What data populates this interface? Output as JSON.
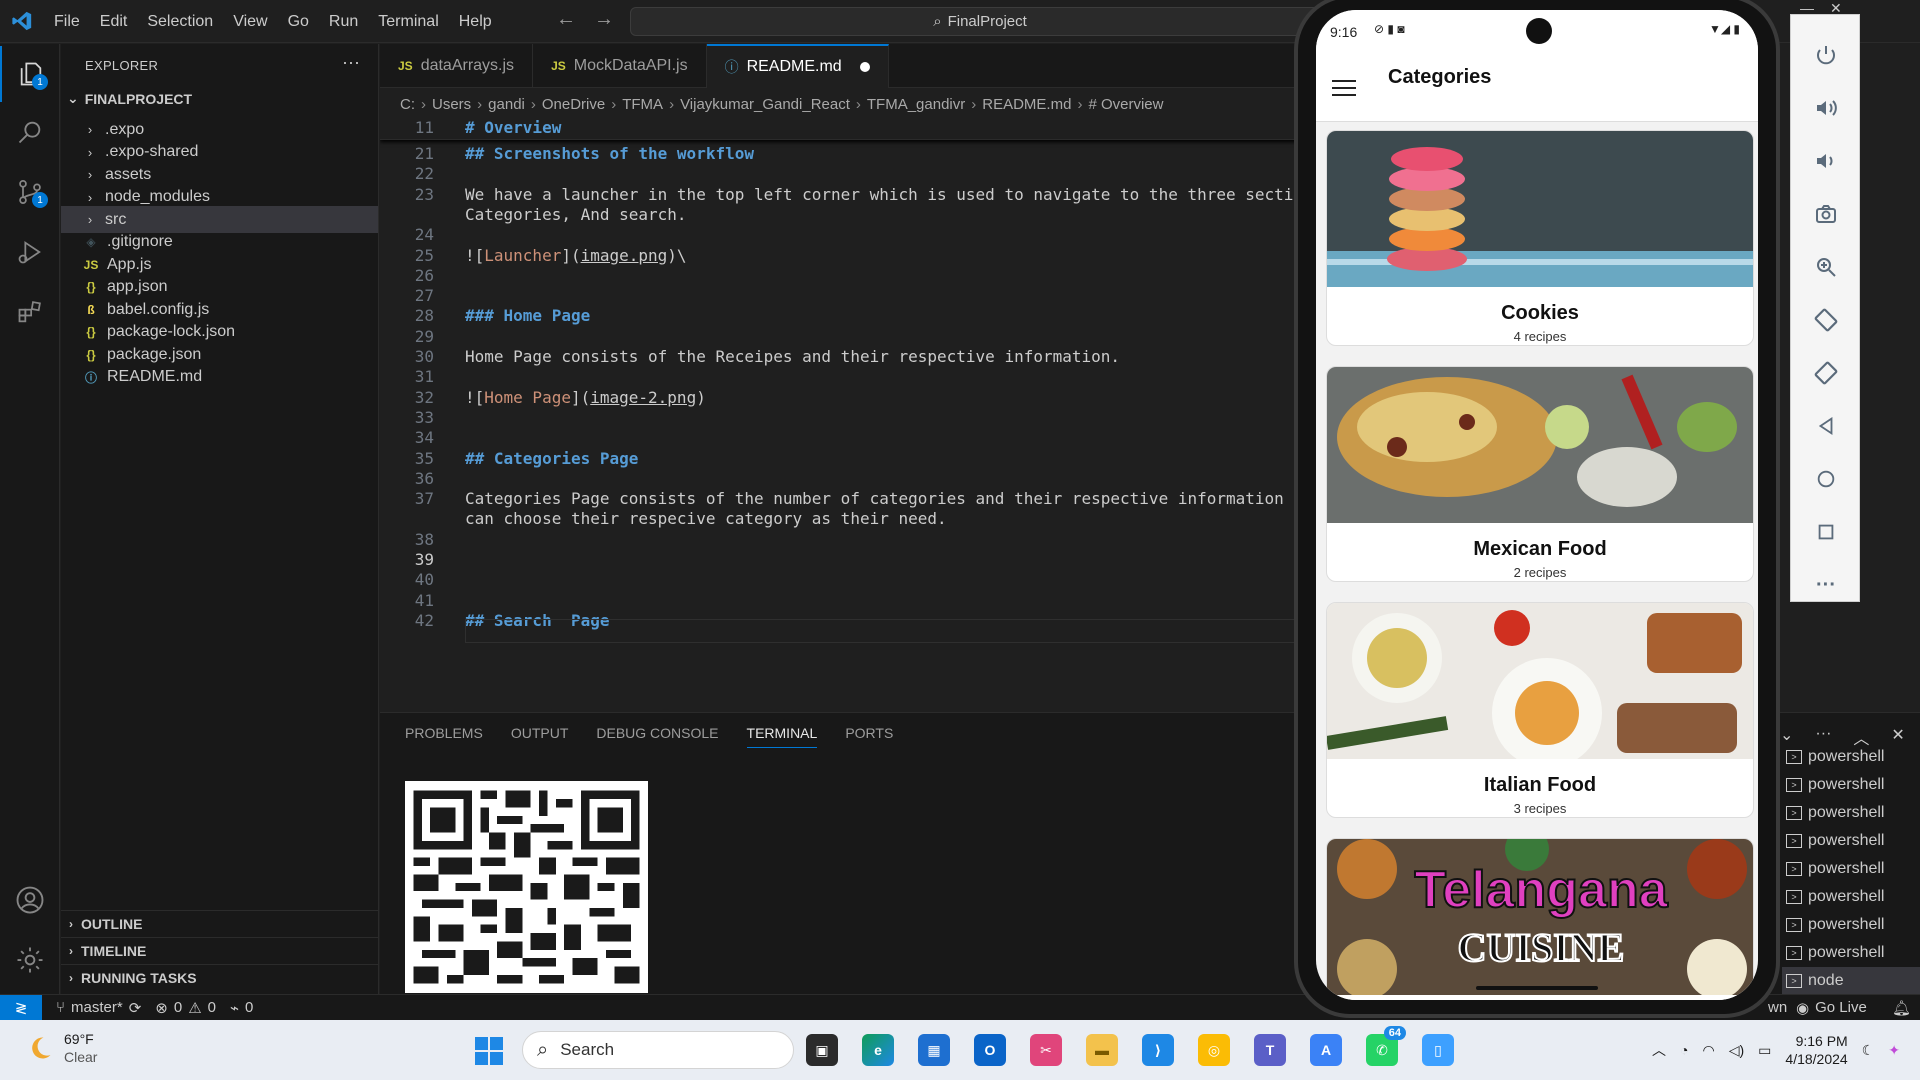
{
  "titlebar": {
    "menu": [
      "File",
      "Edit",
      "Selection",
      "View",
      "Go",
      "Run",
      "Terminal",
      "Help"
    ],
    "search": "FinalProject"
  },
  "activity": {
    "explorer_badge": "1",
    "scm_badge": "1"
  },
  "sidebar": {
    "title": "EXPLORER",
    "project": "FINALPROJECT",
    "items": [
      {
        "label": ".expo",
        "type": "folder"
      },
      {
        "label": ".expo-shared",
        "type": "folder"
      },
      {
        "label": "assets",
        "type": "folder"
      },
      {
        "label": "node_modules",
        "type": "folder"
      },
      {
        "label": "src",
        "type": "folder"
      },
      {
        "label": ".gitignore",
        "type": "file"
      },
      {
        "label": "App.js",
        "type": "js"
      },
      {
        "label": "app.json",
        "type": "json"
      },
      {
        "label": "babel.config.js",
        "type": "babel"
      },
      {
        "label": "package-lock.json",
        "type": "json"
      },
      {
        "label": "package.json",
        "type": "json"
      },
      {
        "label": "README.md",
        "type": "md"
      }
    ],
    "sections": [
      "OUTLINE",
      "TIMELINE",
      "RUNNING TASKS"
    ]
  },
  "tabs": [
    {
      "label": "dataArrays.js",
      "icon": "JS"
    },
    {
      "label": "MockDataAPI.js",
      "icon": "JS"
    },
    {
      "label": "README.md",
      "icon": "ⓘ"
    }
  ],
  "breadcrumb": [
    "C:",
    "Users",
    "gandi",
    "OneDrive",
    "TFMA",
    "Vijaykumar_Gandi_React",
    "TFMA_gandivr",
    "README.md",
    "# Overview"
  ],
  "editor": {
    "sticky_line": "11",
    "sticky_text": "# Overview",
    "lines": [
      {
        "n": "21",
        "text": "## Screenshots of the workflow"
      },
      {
        "n": "22",
        "text": ""
      },
      {
        "n": "23",
        "text": "We have a launcher in the top left corner which is used to navigate to the three secti"
      },
      {
        "n": "",
        "text": "Categories, And search."
      },
      {
        "n": "24",
        "text": ""
      },
      {
        "n": "25",
        "pre": "![",
        "link": "Launcher",
        "mid": "](",
        "url": "image.png",
        "post": ")\\"
      },
      {
        "n": "26",
        "text": ""
      },
      {
        "n": "27",
        "text": ""
      },
      {
        "n": "28",
        "text": "### Home Page"
      },
      {
        "n": "29",
        "text": ""
      },
      {
        "n": "30",
        "text": "Home Page consists of the Receipes and their respective information."
      },
      {
        "n": "31",
        "text": ""
      },
      {
        "n": "32",
        "pre": "![",
        "link": "Home Page",
        "mid": "](",
        "url": "image-2.png",
        "post": ")"
      },
      {
        "n": "33",
        "text": ""
      },
      {
        "n": "34",
        "text": ""
      },
      {
        "n": "35",
        "text": "## Categories Page"
      },
      {
        "n": "36",
        "text": ""
      },
      {
        "n": "37",
        "text": "Categories Page consists of the number of categories and their respective information i"
      },
      {
        "n": "",
        "text": "can choose their respecive category as their need."
      },
      {
        "n": "38",
        "text": ""
      },
      {
        "n": "39",
        "text": ""
      },
      {
        "n": "40",
        "text": ""
      },
      {
        "n": "41",
        "text": ""
      },
      {
        "n": "42",
        "text": "## Search  Page"
      }
    ]
  },
  "panel": {
    "tabs": [
      "PROBLEMS",
      "OUTPUT",
      "DEBUG CONSOLE",
      "TERMINAL",
      "PORTS"
    ],
    "terminals": [
      "powershell",
      "powershell",
      "powershell",
      "powershell",
      "powershell",
      "powershell",
      "powershell",
      "powershell",
      "node"
    ]
  },
  "statusbar": {
    "branch": "master*",
    "errors": "0",
    "warnings": "0",
    "ports": "0",
    "right_partial": "wn",
    "golive": "Go Live"
  },
  "phone": {
    "time": "9:16",
    "title": "Categories",
    "cards": [
      {
        "title": "Cookies",
        "count": "4 recipes"
      },
      {
        "title": "Mexican Food",
        "count": "2 recipes"
      },
      {
        "title": "Italian Food",
        "count": "3 recipes"
      },
      {
        "title": "",
        "count": ""
      }
    ],
    "banner_line1": "Telangana",
    "banner_line2": "CUISINE"
  },
  "taskbar": {
    "temp": "69°F",
    "condition": "Clear",
    "search": "Search",
    "whatsapp_badge": "64",
    "time": "9:16 PM",
    "date": "4/18/2024"
  },
  "colors": {
    "accent": "#0078d4",
    "editor_bg": "#1f1f1f",
    "sidebar_bg": "#181818",
    "heading": "#569cd6"
  }
}
